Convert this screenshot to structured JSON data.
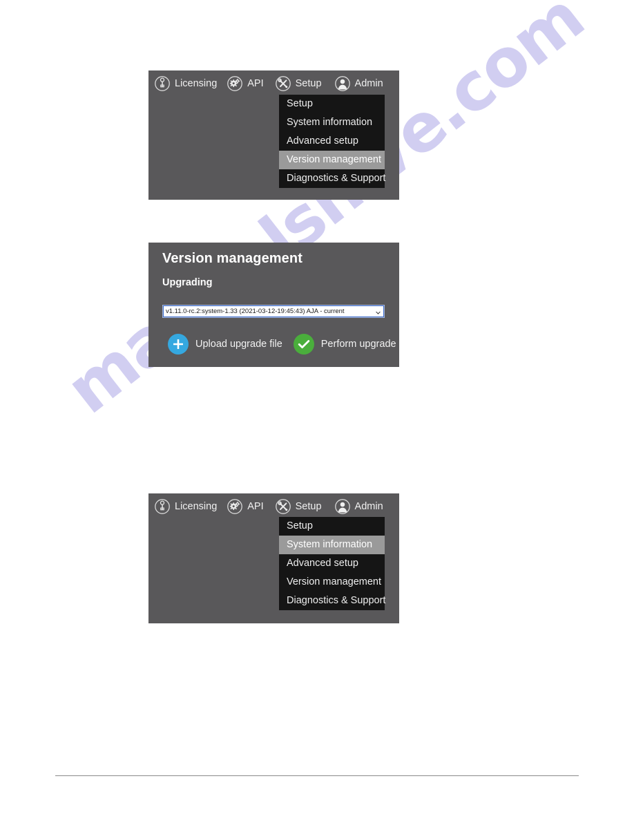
{
  "page": {
    "background": "#ffffff",
    "watermark_text": "manualshive.com",
    "watermark_color": "#c9c6ef"
  },
  "colors": {
    "panel_background": "#59585a",
    "menu_background": "#151515",
    "menu_selected_background": "#9a9a9a",
    "upload_button": "#35a8e0",
    "perform_button": "#4aae3c",
    "select_border_focus": "#3a69c9"
  },
  "navbar": {
    "items": [
      {
        "label": "Licensing",
        "icon": "key-circle-icon"
      },
      {
        "label": "API",
        "icon": "gears-circle-icon"
      },
      {
        "label": "Setup",
        "icon": "tools-circle-icon"
      },
      {
        "label": "Admin",
        "icon": "user-circle-icon"
      }
    ]
  },
  "setup_menu": {
    "items": [
      {
        "label": "Setup"
      },
      {
        "label": "System information"
      },
      {
        "label": "Advanced setup"
      },
      {
        "label": "Version management"
      },
      {
        "label": "Diagnostics & Support"
      }
    ]
  },
  "panel_one": {
    "selected_menu_index": 3,
    "selected_menu_label": "Version management"
  },
  "panel_three": {
    "selected_menu_index": 1,
    "selected_menu_label": "System information"
  },
  "version_management": {
    "title": "Version management",
    "subtitle": "Upgrading",
    "select": {
      "value": "v1.11.0-rc.2:system-1.33 (2021-03-12-19:45:43) AJA - current",
      "options": [
        "v1.11.0-rc.2:system-1.33 (2021-03-12-19:45:43) AJA - current"
      ]
    },
    "actions": [
      {
        "label": "Upload upgrade file",
        "icon": "plus-icon",
        "color": "blue"
      },
      {
        "label": "Perform upgrade",
        "icon": "check-icon",
        "color": "green"
      }
    ]
  }
}
